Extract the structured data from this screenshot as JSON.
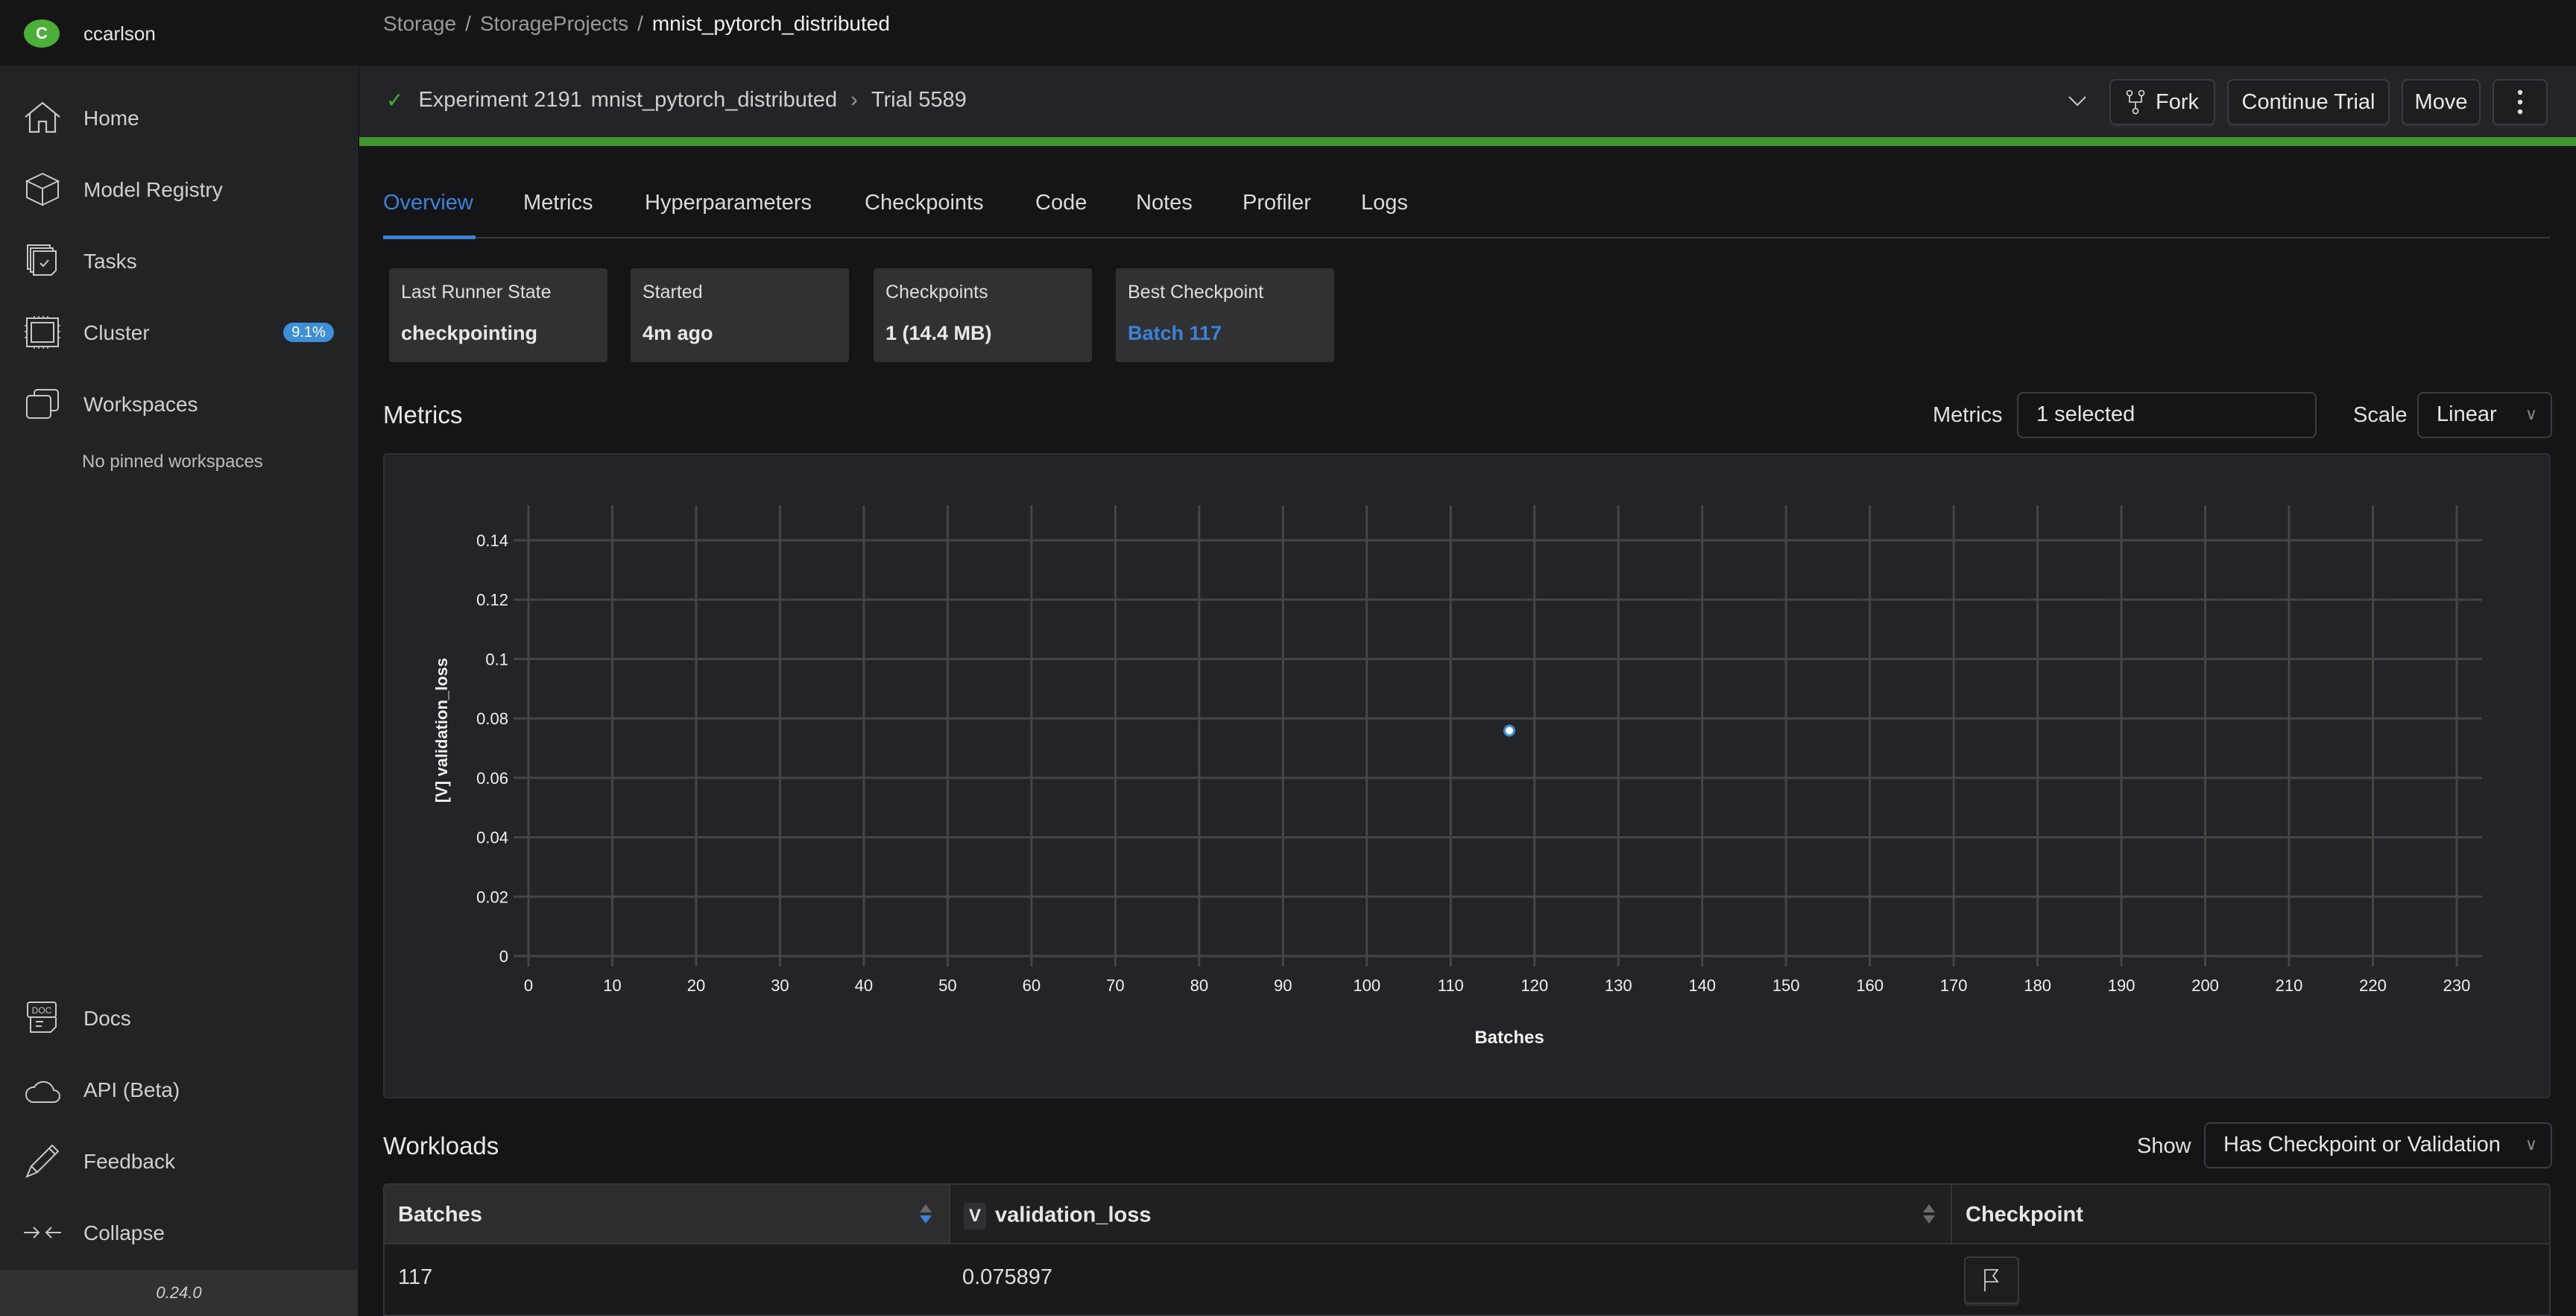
{
  "sidebar": {
    "user": {
      "initial": "C",
      "name": "ccarlson"
    },
    "nav": [
      {
        "label": "Home",
        "icon": "home-icon"
      },
      {
        "label": "Model Registry",
        "icon": "cube-icon"
      },
      {
        "label": "Tasks",
        "icon": "tasks-icon"
      },
      {
        "label": "Cluster",
        "icon": "chip-icon",
        "badge": "9.1%"
      },
      {
        "label": "Workspaces",
        "icon": "workspaces-icon"
      }
    ],
    "no_pinned": "No pinned workspaces",
    "bottom": [
      {
        "label": "Docs",
        "icon": "docs-icon"
      },
      {
        "label": "API (Beta)",
        "icon": "cloud-icon"
      },
      {
        "label": "Feedback",
        "icon": "pencil-icon"
      },
      {
        "label": "Collapse",
        "icon": "collapse-icon"
      }
    ],
    "version": "0.24.0"
  },
  "breadcrumb": [
    {
      "label": "Storage"
    },
    {
      "label": "StorageProjects"
    },
    {
      "label": "mnist_pytorch_distributed"
    }
  ],
  "breadcrumb_sep": "/",
  "trial_header": {
    "experiment": "Experiment 2191",
    "experiment_name": "mnist_pytorch_distributed",
    "trial": "Trial 5589",
    "status_color": "#4caf3a",
    "progress": 1.0,
    "buttons": {
      "fork": "Fork",
      "continue": "Continue Trial",
      "move": "Move"
    }
  },
  "tabs": [
    {
      "label": "Overview",
      "active": true
    },
    {
      "label": "Metrics"
    },
    {
      "label": "Hyperparameters"
    },
    {
      "label": "Checkpoints"
    },
    {
      "label": "Code"
    },
    {
      "label": "Notes"
    },
    {
      "label": "Profiler"
    },
    {
      "label": "Logs"
    }
  ],
  "cards": [
    {
      "title": "Last Runner State",
      "value": "checkpointing"
    },
    {
      "title": "Started",
      "value": "4m ago"
    },
    {
      "title": "Checkpoints",
      "value": "1 (14.4 MB)"
    },
    {
      "title": "Best Checkpoint",
      "value": "Batch 117",
      "link": true
    }
  ],
  "metrics_section": {
    "title": "Metrics",
    "metrics_label": "Metrics",
    "metrics_value": "1 selected",
    "scale_label": "Scale",
    "scale_value": "Linear"
  },
  "chart_data": {
    "type": "scatter",
    "title": "",
    "xlabel": "Batches",
    "ylabel": "[V] validation_loss",
    "xlim": [
      0,
      233
    ],
    "ylim": [
      0,
      0.14
    ],
    "x_ticks": [
      0,
      10,
      20,
      30,
      40,
      50,
      60,
      70,
      80,
      90,
      100,
      110,
      120,
      130,
      140,
      150,
      160,
      170,
      180,
      190,
      200,
      210,
      220,
      230
    ],
    "y_ticks": [
      0,
      0.02,
      0.04,
      0.06,
      0.08,
      0.1,
      0.12,
      0.14
    ],
    "y_tick_labels": [
      "0",
      "0.02",
      "0.04",
      "0.06",
      "0.08",
      "0.1",
      "0.12",
      "0.14"
    ],
    "grid": true,
    "series": [
      {
        "name": "validation_loss",
        "color": "#3d8fd6",
        "points": [
          {
            "x": 117,
            "y": 0.075897
          }
        ]
      }
    ]
  },
  "workloads": {
    "title": "Workloads",
    "show_label": "Show",
    "show_value": "Has Checkpoint or Validation",
    "columns": [
      {
        "label": "Batches",
        "sort": "desc"
      },
      {
        "label": "validation_loss",
        "badge": "V",
        "sort": "none"
      },
      {
        "label": "Checkpoint"
      }
    ],
    "rows": [
      {
        "batches": "117",
        "validation_loss": "0.075897",
        "checkpoint_icon": "flag-icon"
      }
    ]
  }
}
